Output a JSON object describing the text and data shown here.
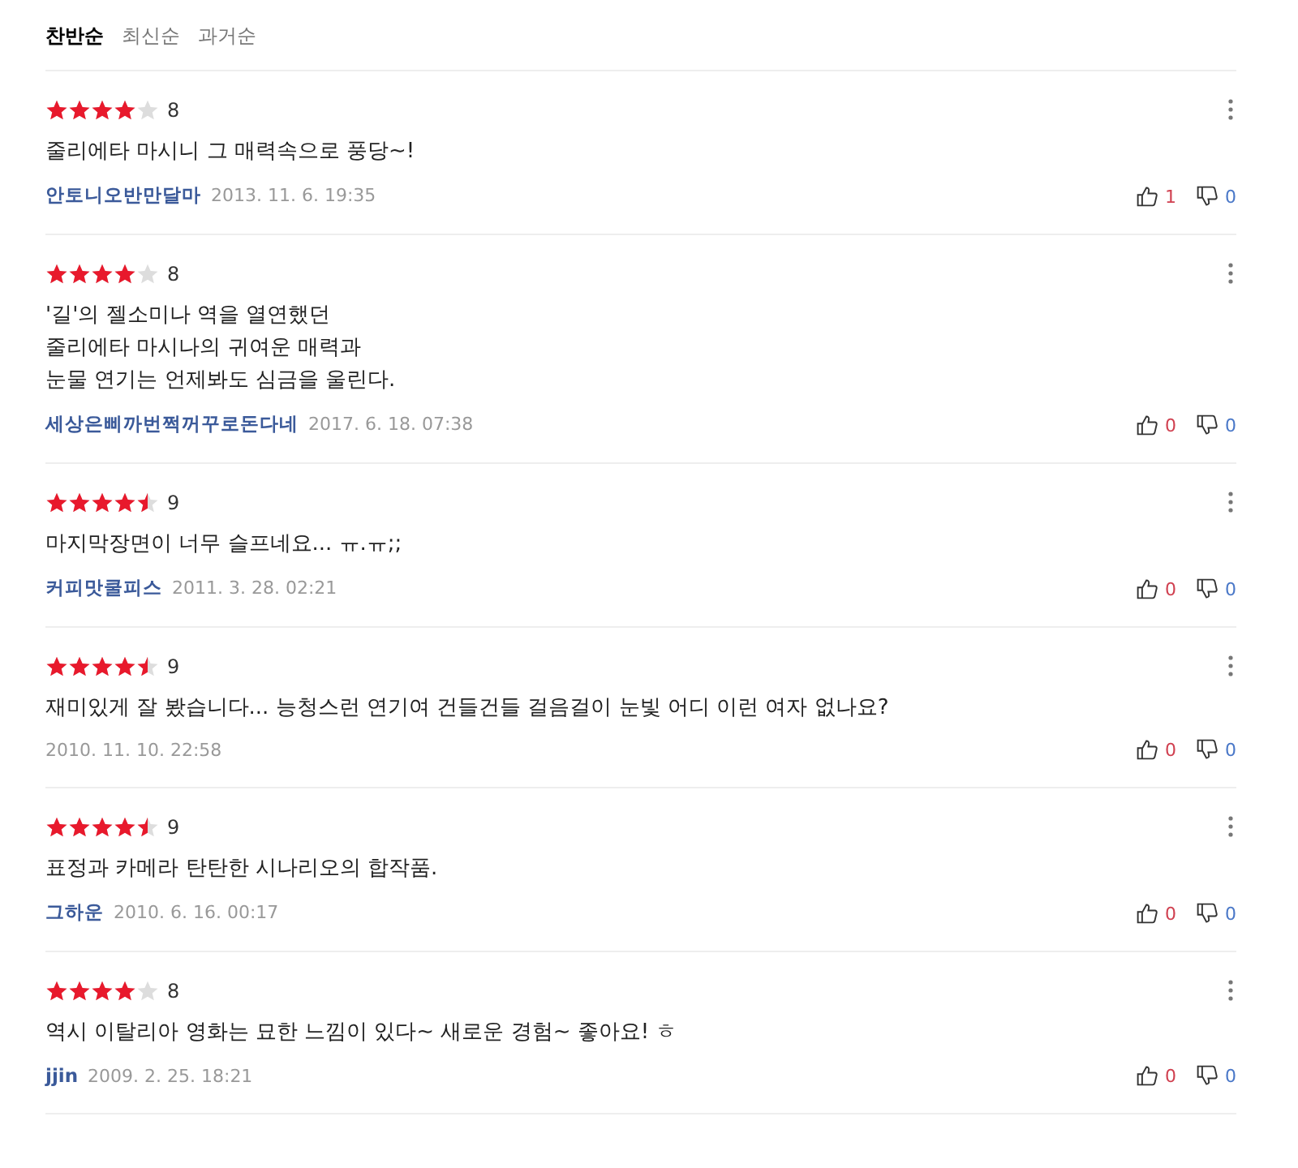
{
  "sort_tabs": [
    {
      "label": "찬반순",
      "selected": true
    },
    {
      "label": "최신순",
      "selected": false
    },
    {
      "label": "과거순",
      "selected": false
    }
  ],
  "reviews": [
    {
      "stars": 4,
      "score": "8",
      "text": "줄리에타 마시니 그 매력속으로 풍당~!",
      "author": "안토니오반만달마",
      "date": "2013. 11. 6. 19:35",
      "likes": "1",
      "dislikes": "0"
    },
    {
      "stars": 4,
      "score": "8",
      "text": "'길'의 젤소미나 역을 열연했던\n줄리에타 마시나의 귀여운 매력과\n눈물 연기는 언제봐도 심금을 울린다.",
      "author": "세상은삐까번쩍꺼꾸로돈다네",
      "date": "2017. 6. 18. 07:38",
      "likes": "0",
      "dislikes": "0"
    },
    {
      "stars": 4.5,
      "score": "9",
      "text": "마지막장면이 너무 슬프네요... ㅠ.ㅠ;;",
      "author": "커피맛쿨피스",
      "date": "2011. 3. 28. 02:21",
      "likes": "0",
      "dislikes": "0"
    },
    {
      "stars": 4.5,
      "score": "9",
      "text": "재미있게 잘 봤습니다... 능청스런 연기여 건들건들 걸음걸이 눈빛 어디 이런 여자 없나요?",
      "date": "2010. 11. 10. 22:58",
      "likes": "0",
      "dislikes": "0"
    },
    {
      "stars": 4.5,
      "score": "9",
      "text": "표정과 카메라 탄탄한 시나리오의 합작품.",
      "author": "그하운",
      "date": "2010. 6. 16. 00:17",
      "likes": "0",
      "dislikes": "0"
    },
    {
      "stars": 4,
      "score": "8",
      "text": "역시 이탈리아 영화는 묘한 느낌이 있다~ 새로운 경험~ 좋아요! ㅎ",
      "author": "jjin",
      "date": "2009. 2. 25. 18:21",
      "likes": "0",
      "dislikes": "0"
    }
  ]
}
